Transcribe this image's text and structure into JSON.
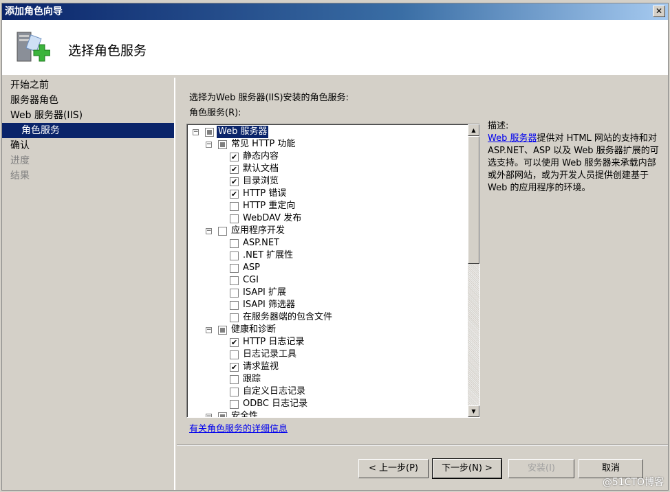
{
  "window": {
    "title": "添加角色向导",
    "close": "✕"
  },
  "header": {
    "title": "选择角色服务",
    "icon": "server-add-icon"
  },
  "nav": {
    "items": [
      {
        "label": "开始之前",
        "state": "normal"
      },
      {
        "label": "服务器角色",
        "state": "normal"
      },
      {
        "label": "Web 服务器(IIS)",
        "state": "normal"
      },
      {
        "label": "角色服务",
        "state": "selected"
      },
      {
        "label": "确认",
        "state": "normal"
      },
      {
        "label": "进度",
        "state": "disabled"
      },
      {
        "label": "结果",
        "state": "disabled"
      }
    ]
  },
  "main": {
    "instruction": "选择为Web 服务器(IIS)安装的角色服务:",
    "list_label": "角色服务(R):",
    "tree": [
      {
        "label": "Web 服务器",
        "level": 0,
        "state": "partial",
        "expander": "−",
        "selected": true
      },
      {
        "label": "常见 HTTP 功能",
        "level": 1,
        "state": "partial",
        "expander": "−"
      },
      {
        "label": "静态内容",
        "level": 2,
        "state": "checked"
      },
      {
        "label": "默认文档",
        "level": 2,
        "state": "checked"
      },
      {
        "label": "目录浏览",
        "level": 2,
        "state": "checked"
      },
      {
        "label": "HTTP 错误",
        "level": 2,
        "state": "checked"
      },
      {
        "label": "HTTP 重定向",
        "level": 2,
        "state": "unchecked"
      },
      {
        "label": "WebDAV 发布",
        "level": 2,
        "state": "unchecked"
      },
      {
        "label": "应用程序开发",
        "level": 1,
        "state": "unchecked",
        "expander": "−"
      },
      {
        "label": "ASP.NET",
        "level": 2,
        "state": "unchecked"
      },
      {
        "label": ".NET 扩展性",
        "level": 2,
        "state": "unchecked"
      },
      {
        "label": "ASP",
        "level": 2,
        "state": "unchecked"
      },
      {
        "label": "CGI",
        "level": 2,
        "state": "unchecked"
      },
      {
        "label": "ISAPI 扩展",
        "level": 2,
        "state": "unchecked"
      },
      {
        "label": "ISAPI 筛选器",
        "level": 2,
        "state": "unchecked"
      },
      {
        "label": "在服务器端的包含文件",
        "level": 2,
        "state": "unchecked"
      },
      {
        "label": "健康和诊断",
        "level": 1,
        "state": "partial",
        "expander": "−"
      },
      {
        "label": "HTTP 日志记录",
        "level": 2,
        "state": "checked"
      },
      {
        "label": "日志记录工具",
        "level": 2,
        "state": "unchecked"
      },
      {
        "label": "请求监视",
        "level": 2,
        "state": "checked"
      },
      {
        "label": "跟踪",
        "level": 2,
        "state": "unchecked"
      },
      {
        "label": "自定义日志记录",
        "level": 2,
        "state": "unchecked"
      },
      {
        "label": "ODBC 日志记录",
        "level": 2,
        "state": "unchecked"
      },
      {
        "label": "安全性",
        "level": 1,
        "state": "partial",
        "expander": "−"
      }
    ],
    "more_info_link": "有关角色服务的详细信息",
    "description": {
      "label": "描述:",
      "link": "Web 服务器",
      "text": "提供对 HTML 网站的支持和对 ASP.NET、ASP 以及 Web 服务器扩展的可选支持。可以使用 Web 服务器来承载内部或外部网站，或为开发人员提供创建基于 Web 的应用程序的环境。"
    }
  },
  "buttons": {
    "prev": "< 上一步(P)",
    "next": "下一步(N) >",
    "install": "安装(I)",
    "cancel": "取消"
  },
  "watermark": "@51CTO博客"
}
